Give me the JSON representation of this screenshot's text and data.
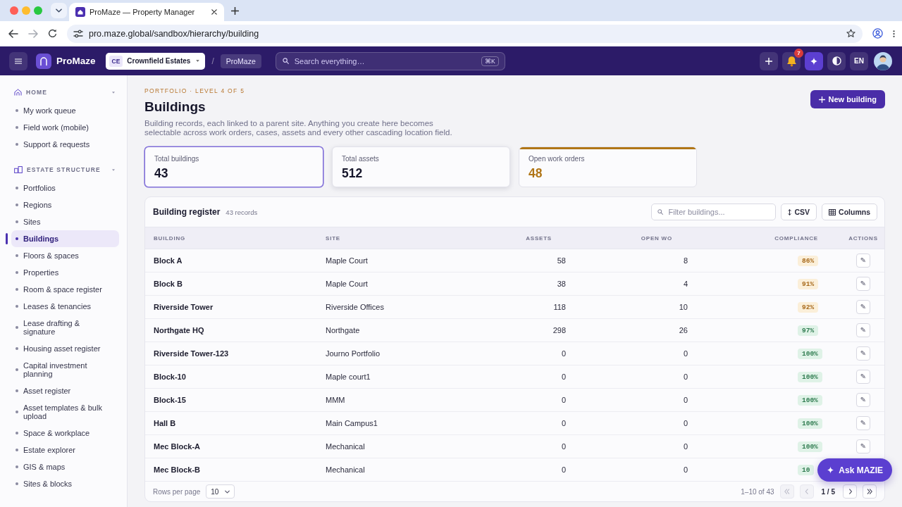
{
  "browser": {
    "tab_title": "ProMaze — Property Manager",
    "url": "pro.maze.global/sandbox/hierarchy/building"
  },
  "appbar": {
    "brand": "ProMaze",
    "org_initials": "CE",
    "org_name": "Crownfield Estates",
    "separator": "/",
    "crumb": "ProMaze",
    "search": {
      "placeholder": "Search everything…",
      "shortcut": "⌘K"
    },
    "notification_count": "7",
    "language": "EN"
  },
  "sidebar": {
    "sections": [
      {
        "kind": "home",
        "title": "HOME",
        "expanded": true,
        "items": [
          {
            "label": "My work queue",
            "selected": false
          },
          {
            "label": "Field work (mobile)",
            "selected": false
          },
          {
            "label": "Support & requests",
            "selected": false
          }
        ]
      },
      {
        "kind": "structure",
        "title": "ESTATE STRUCTURE",
        "expanded": true,
        "items": [
          {
            "label": "Portfolios",
            "selected": false
          },
          {
            "label": "Regions",
            "selected": false
          },
          {
            "label": "Sites",
            "selected": false
          },
          {
            "label": "Buildings",
            "selected": true
          },
          {
            "label": "Floors & spaces",
            "selected": false
          },
          {
            "label": "Properties",
            "selected": false
          },
          {
            "label": "Room & space register",
            "selected": false
          },
          {
            "label": "Leases & tenancies",
            "selected": false
          },
          {
            "label": "Lease drafting & signature",
            "selected": false
          },
          {
            "label": "Housing asset register",
            "selected": false
          },
          {
            "label": "Capital investment planning",
            "selected": false
          },
          {
            "label": "Asset register",
            "selected": false
          },
          {
            "label": "Asset templates & bulk upload",
            "selected": false
          },
          {
            "label": "Space & workplace",
            "selected": false
          },
          {
            "label": "Estate explorer",
            "selected": false
          },
          {
            "label": "GIS & maps",
            "selected": false
          },
          {
            "label": "Sites & blocks",
            "selected": false
          }
        ]
      }
    ]
  },
  "page": {
    "eyebrow": "PORTFOLIO · LEVEL 4 OF 5",
    "title": "Buildings",
    "description": "Building records, each linked to a parent site. Anything you create here becomes selectable across work orders, cases, assets and every other cascading location field.",
    "action": "New building"
  },
  "stats": [
    {
      "label": "Total buildings",
      "value": "43",
      "selected": true,
      "hovered": false
    },
    {
      "label": "Total assets",
      "value": "512",
      "selected": false,
      "hovered": true
    },
    {
      "label": "Open work orders",
      "value": "48",
      "selected": false,
      "hovered": false,
      "color": "#b07516"
    }
  ],
  "register": {
    "title": "Building register",
    "count": "43 records",
    "filter": {
      "placeholder": "Filter buildings..."
    },
    "buttons": [
      {
        "kind": "export",
        "label": "CSV"
      },
      {
        "kind": "columns",
        "label": "Columns"
      }
    ],
    "columns": [
      "BUILDING",
      "SITE",
      "ASSETS",
      "OPEN WO",
      "COMPLIANCE",
      "ACTIONS"
    ],
    "rows": [
      {
        "building": "Block A",
        "site": "Maple Court",
        "assets": "58",
        "open_wo": "8",
        "compliance": "86%",
        "kind": "warning",
        "action": "✎"
      },
      {
        "building": "Block B",
        "site": "Maple Court",
        "assets": "38",
        "open_wo": "4",
        "compliance": "91%",
        "kind": "warning",
        "action": "✎"
      },
      {
        "building": "Riverside Tower",
        "site": "Riverside Offices",
        "assets": "118",
        "open_wo": "10",
        "compliance": "92%",
        "kind": "warning",
        "action": "✎"
      },
      {
        "building": "Northgate HQ",
        "site": "Northgate",
        "assets": "298",
        "open_wo": "26",
        "compliance": "97%",
        "kind": "success",
        "action": "✎"
      },
      {
        "building": "Riverside Tower-123",
        "site": "Journo Portfolio",
        "assets": "0",
        "open_wo": "0",
        "compliance": "100%",
        "kind": "success",
        "action": "✎"
      },
      {
        "building": "Block-10",
        "site": "Maple court1",
        "assets": "0",
        "open_wo": "0",
        "compliance": "100%",
        "kind": "success",
        "action": "✎"
      },
      {
        "building": "Block-15",
        "site": "MMM",
        "assets": "0",
        "open_wo": "0",
        "compliance": "100%",
        "kind": "success",
        "action": "✎"
      },
      {
        "building": "Hall B",
        "site": "Main Campus1",
        "assets": "0",
        "open_wo": "0",
        "compliance": "100%",
        "kind": "success",
        "action": "✎"
      },
      {
        "building": "Mec Block-A",
        "site": "Mechanical",
        "assets": "0",
        "open_wo": "0",
        "compliance": "100%",
        "kind": "success",
        "action": "✎"
      },
      {
        "building": "Mec Block-B",
        "site": "Mechanical",
        "assets": "0",
        "open_wo": "0",
        "compliance": "10",
        "kind": "success"
      }
    ],
    "footer": {
      "rows_label": "Rows per page",
      "page_size": "10",
      "range": "1–10 of 43",
      "page": "1 / 5",
      "pager": [
        {
          "kind": "first",
          "disabled": true
        },
        {
          "kind": "prev",
          "disabled": true
        },
        {
          "kind": "next",
          "disabled": false
        },
        {
          "kind": "last",
          "disabled": false
        }
      ]
    }
  },
  "assistant": {
    "label": "Ask MAZIE"
  }
}
